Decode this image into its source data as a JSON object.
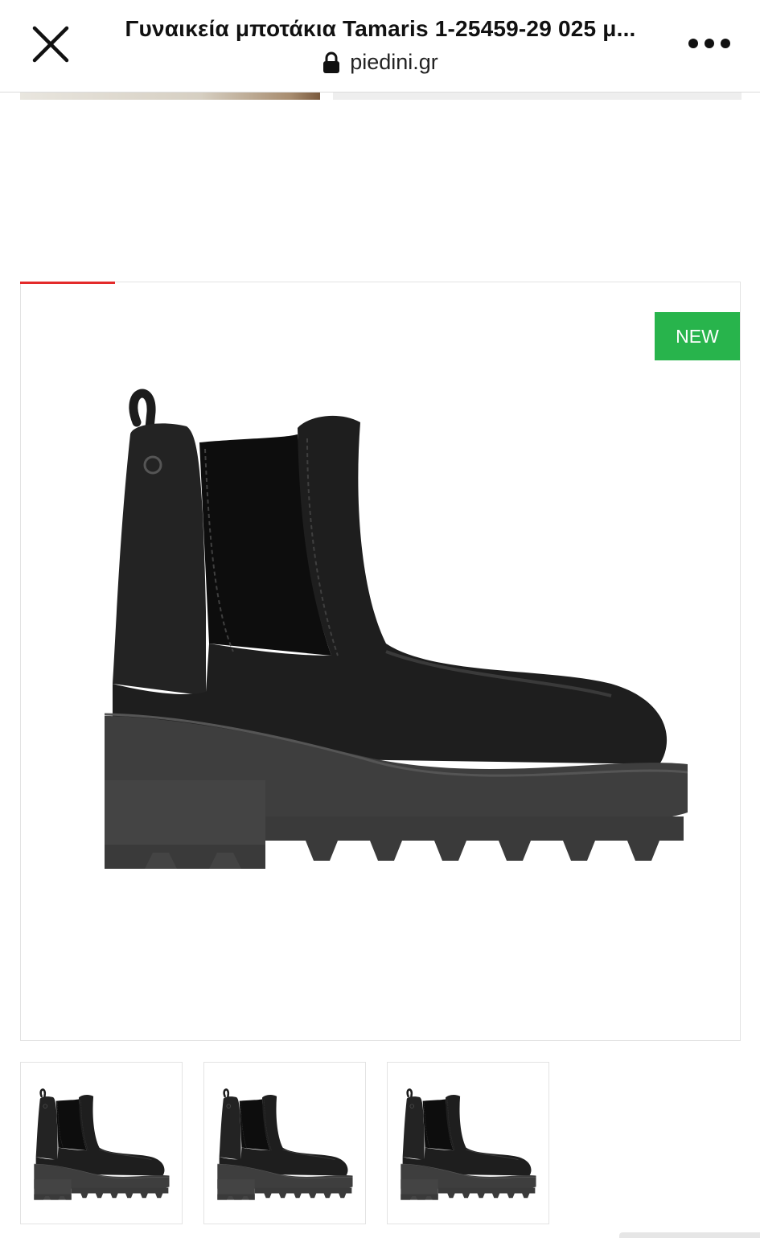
{
  "browser": {
    "page_title": "Γυναικεία μποτάκια Tamaris 1-25459-29 025 μ...",
    "domain": "piedini.gr",
    "close_icon": "close-icon",
    "lock_icon": "lock-icon",
    "more_icon": "more-options-icon"
  },
  "product_gallery": {
    "badge": "NEW",
    "badge_color": "#28b44c",
    "active_tab_color": "#e32a2a",
    "main_image": "black-chelsea-ankle-boot",
    "thumbnails": [
      "boot-side-view",
      "boot-front-angle-view",
      "boot-side-view-alt"
    ]
  }
}
